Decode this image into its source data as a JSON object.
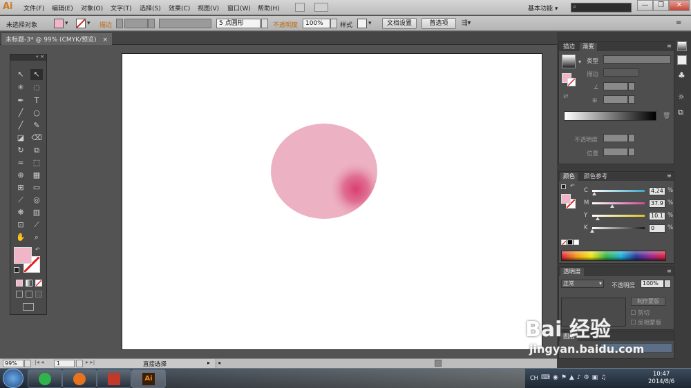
{
  "app": {
    "logo": "Ai",
    "workspace": "基本功能",
    "workspace_arrow": "▾"
  },
  "menu": [
    "文件(F)",
    "编辑(E)",
    "对象(O)",
    "文字(T)",
    "选择(S)",
    "效果(C)",
    "视图(V)",
    "窗口(W)",
    "帮助(H)"
  ],
  "window_controls": {
    "minimize": "—",
    "restore": "❐",
    "close": "✕"
  },
  "control_bar": {
    "selection_label": "未选择对象",
    "stroke_label": "描边",
    "brush_value": "5 点圆形",
    "opacity_label": "不透明度",
    "opacity_value": "100%",
    "style_label": "样式",
    "doc_setup_button": "文档设置",
    "preferences_button": "首选项"
  },
  "document_tab": {
    "title": "未标题-3* @ 99% (CMYK/预览)",
    "close": "×"
  },
  "status_bar": {
    "zoom": "99%",
    "page": "1",
    "tool": "直接选择"
  },
  "gradient_panel": {
    "tabs": [
      "描边",
      "渐变"
    ],
    "type_label": "类型",
    "stroke_label": "描边",
    "opacity_label": "不透明度",
    "position_label": "位置"
  },
  "color_panel": {
    "tabs": [
      "颜色",
      "颜色参考"
    ],
    "channels": [
      {
        "label": "C",
        "value": "4.24",
        "unit": "%",
        "fraction": 0.0424,
        "track": "#3fa8c8"
      },
      {
        "label": "M",
        "value": "37.9",
        "unit": "%",
        "fraction": 0.379,
        "track": "#d4479c"
      },
      {
        "label": "Y",
        "value": "10.1",
        "unit": "%",
        "fraction": 0.101,
        "track": "#e2c227"
      },
      {
        "label": "K",
        "value": "0",
        "unit": "%",
        "fraction": 0.0,
        "track": "#1b1b1b"
      }
    ]
  },
  "transparency_panel": {
    "tab": "透明度",
    "blend_mode": "正常",
    "opacity_label": "不透明度",
    "opacity_value": "100%",
    "make_mask_button": "制作蒙版",
    "clip_label": "剪切",
    "invert_label": "反相蒙版"
  },
  "layers_panel": {
    "tab": "图层"
  },
  "colors": {
    "fill": "#f0b6c8",
    "circle": "#ecb2c3",
    "mesh_highlight": "#d9406f",
    "accent_orange": "#cc7a1e"
  },
  "taskbar": {
    "lang": "CH",
    "time": "10:47",
    "date": "2014/8/6"
  },
  "watermark": {
    "text": "Bai 经验",
    "url": "jingyan.baidu.com"
  }
}
